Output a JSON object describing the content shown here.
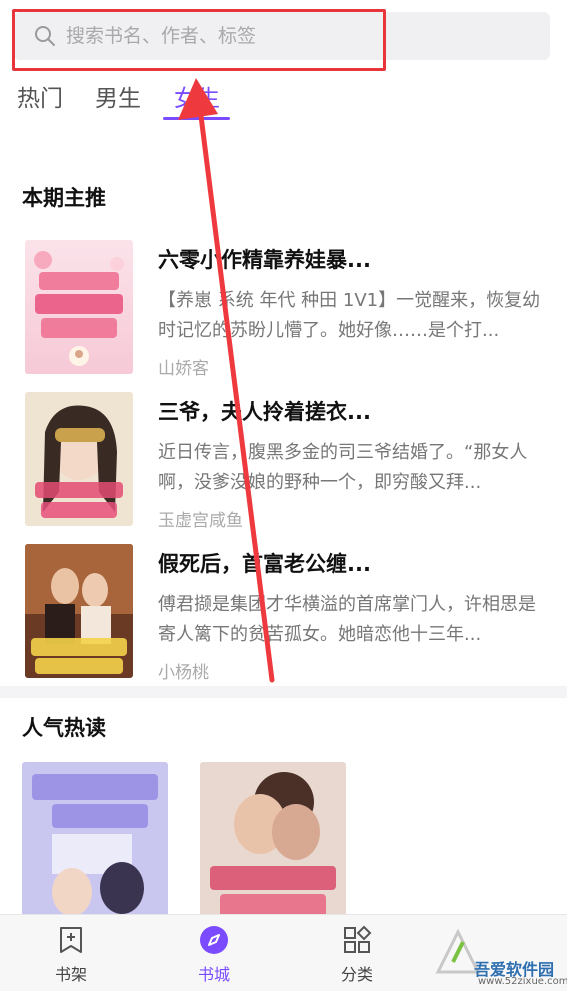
{
  "search": {
    "placeholder": "搜索书名、作者、标签",
    "icon": "search-icon"
  },
  "tabs": [
    {
      "label": "热门",
      "active": false
    },
    {
      "label": "男生",
      "active": false
    },
    {
      "label": "女生",
      "active": true
    }
  ],
  "featured": {
    "title": "本期主推",
    "books": [
      {
        "title": "六零小作精靠养娃暴...",
        "desc": "【养崽 系统 年代 种田 1V1】一觉醒来，恢复幼时记忆的苏盼儿懵了。她好像……是个打...",
        "author": "山娇客",
        "cover_text": "六零小作精靠养娃暴富了"
      },
      {
        "title": "三爷，夫人拎着搓衣...",
        "desc": "近日传言，腹黑多金的司三爷结婚了。“那女人啊，没爹没娘的野种一个，即穷酸又拜...",
        "author": "玉虚宫咸鱼",
        "cover_text": "三爷夫人拎着搓衣板来了"
      },
      {
        "title": "假死后，首富老公缠...",
        "desc": "傅君撷是集团才华横溢的首席掌门人，许相思是寄人篱下的贫苦孤女。她暗恋他十三年...",
        "author": "小杨桃",
        "cover_text": "假死后首富老公缠我生二胎"
      }
    ]
  },
  "popular": {
    "title": "人气热读",
    "books": [
      {
        "cover_text": "嫁给前夫他小舅舅"
      },
      {
        "cover_text": "离婚后薄总追妻"
      }
    ]
  },
  "bottom_nav": [
    {
      "label": "书架",
      "icon": "bookshelf-icon",
      "active": false
    },
    {
      "label": "书城",
      "icon": "compass-icon",
      "active": true
    },
    {
      "label": "分类",
      "icon": "category-grid-icon",
      "active": false
    }
  ],
  "watermark": {
    "text": "吾爱软件园",
    "url": "www.52zixue.com"
  },
  "colors": {
    "accent": "#7b4cff",
    "annotation": "#e8353b"
  }
}
